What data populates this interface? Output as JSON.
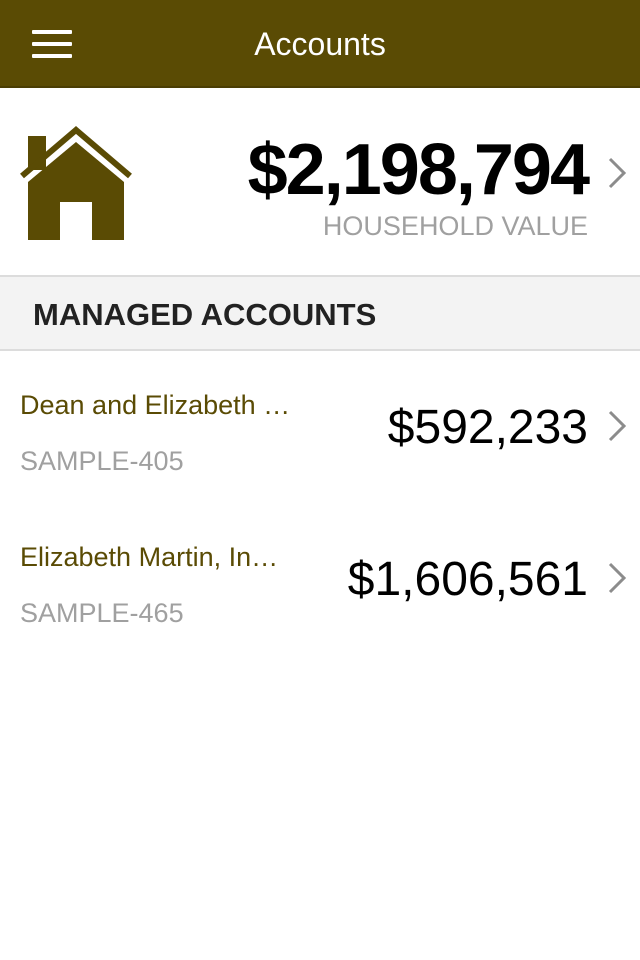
{
  "navbar": {
    "title": "Accounts",
    "menu_icon": "hamburger-menu-icon",
    "background_color": "#5a4b04"
  },
  "household": {
    "icon": "house-icon",
    "value": "$2,198,794",
    "label": "HOUSEHOLD VALUE",
    "chevron_icon": "chevron-right-icon"
  },
  "managed_accounts": {
    "header": "MANAGED ACCOUNTS",
    "items": [
      {
        "name": "Dean and Elizabeth …",
        "number": "SAMPLE-405",
        "value": "$592,233",
        "chevron_icon": "chevron-right-icon"
      },
      {
        "name": "Elizabeth Martin, In…",
        "number": "SAMPLE-465",
        "value": "$1,606,561",
        "chevron_icon": "chevron-right-icon"
      }
    ]
  },
  "colors": {
    "brand": "#5a4b04",
    "accent_text": "#5a4b04",
    "muted_text": "#a0a0a0",
    "chevron": "#8c8c8c"
  }
}
